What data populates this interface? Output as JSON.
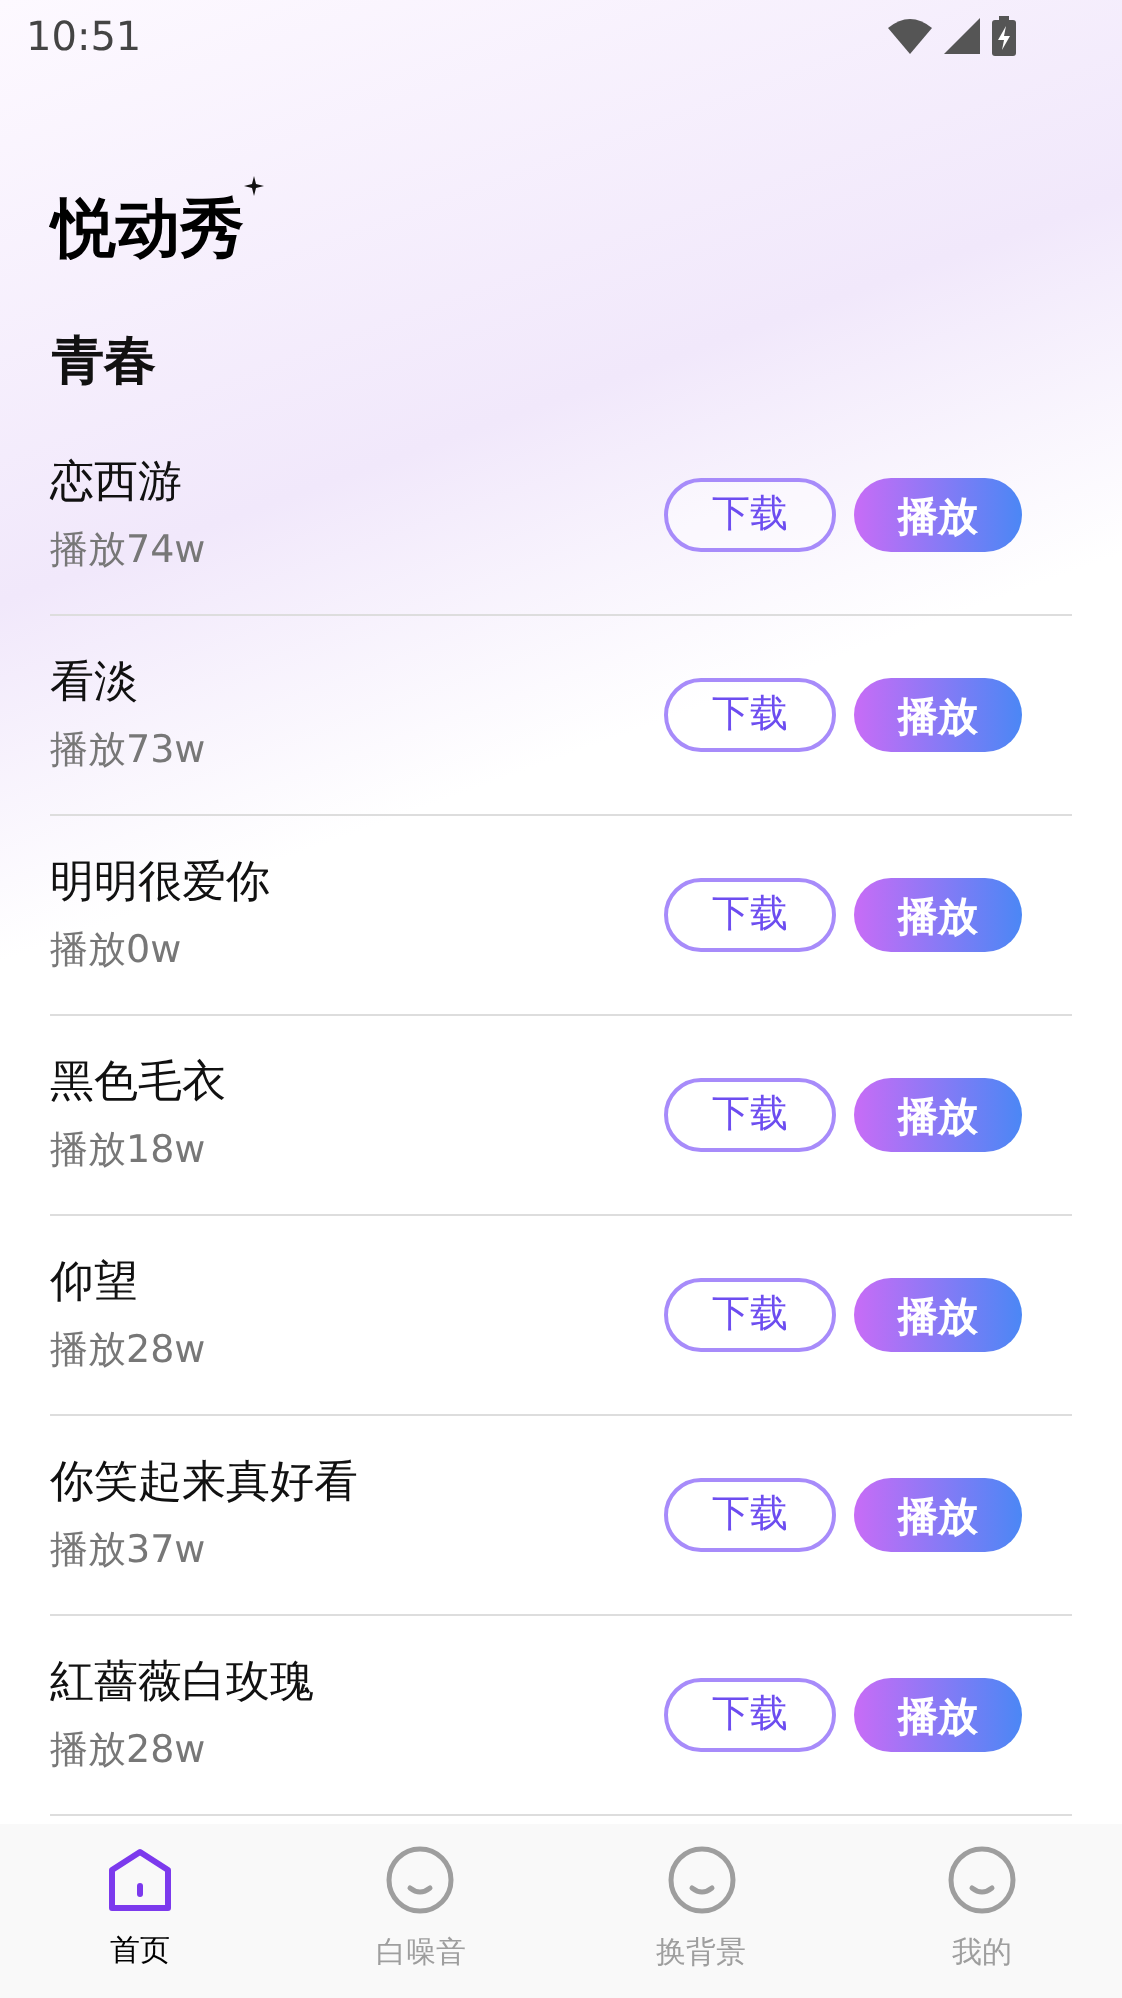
{
  "status_bar": {
    "time": "10:51"
  },
  "app_title": "悦动秀",
  "section": {
    "title": "青春"
  },
  "songs": [
    {
      "name": "恋西游",
      "plays": "播放74w",
      "download": "下载",
      "play": "播放"
    },
    {
      "name": "看淡",
      "plays": "播放73w",
      "download": "下载",
      "play": "播放"
    },
    {
      "name": "明明很爱你",
      "plays": "播放0w",
      "download": "下载",
      "play": "播放"
    },
    {
      "name": "黑色毛衣",
      "plays": "播放18w",
      "download": "下载",
      "play": "播放"
    },
    {
      "name": "仰望",
      "plays": "播放28w",
      "download": "下载",
      "play": "播放"
    },
    {
      "name": "你笑起来真好看",
      "plays": "播放37w",
      "download": "下载",
      "play": "播放"
    },
    {
      "name": "紅薔薇白玫瑰",
      "plays": "播放28w",
      "download": "下载",
      "play": "播放"
    }
  ],
  "tab_bar": [
    {
      "label": "首页",
      "kind": "home",
      "selected": true
    },
    {
      "label": "白噪音",
      "kind": "face",
      "selected": false
    },
    {
      "label": "换背景",
      "kind": "face",
      "selected": false
    },
    {
      "label": "我的",
      "kind": "face",
      "selected": false
    }
  ]
}
